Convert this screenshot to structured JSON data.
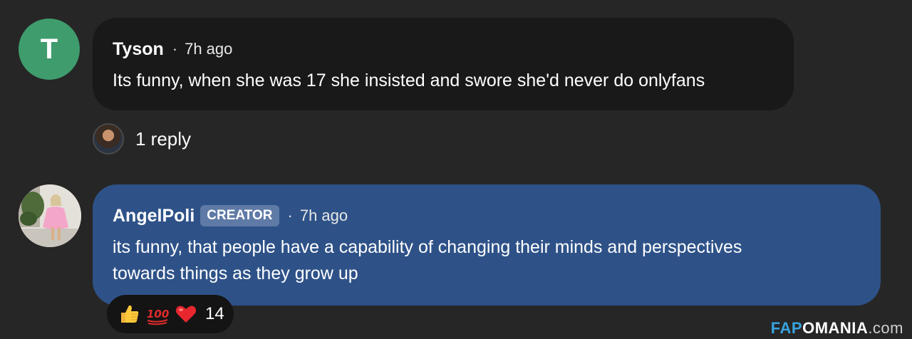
{
  "comments": [
    {
      "avatar_letter": "T",
      "author": "Tyson",
      "separator": "·",
      "time": "7h ago",
      "text": "Its funny, when she was 17 she insisted and swore she'd never do onlyfans",
      "replies_label": "1 reply"
    },
    {
      "author": "AngelPoli",
      "badge": "CREATOR",
      "separator": "·",
      "time": "7h ago",
      "text_line1": "its funny, that people have a capability of changing their minds and perspectives",
      "text_line2": "towards things as they grow up",
      "reactions": {
        "icons": [
          "thumbs-up-icon",
          "hundred-points-icon",
          "red-heart-icon"
        ],
        "count": "14"
      }
    }
  ],
  "watermark": {
    "part1": "FAP",
    "part2": "OMANIA",
    "part3": ".com"
  },
  "colors": {
    "background": "#262626",
    "comment_bubble": "#191919",
    "creator_bubble": "#2e5288",
    "avatar_green": "#3f9c6d",
    "badge": "#5f7aa6",
    "watermark_accent": "#38a3e0"
  }
}
